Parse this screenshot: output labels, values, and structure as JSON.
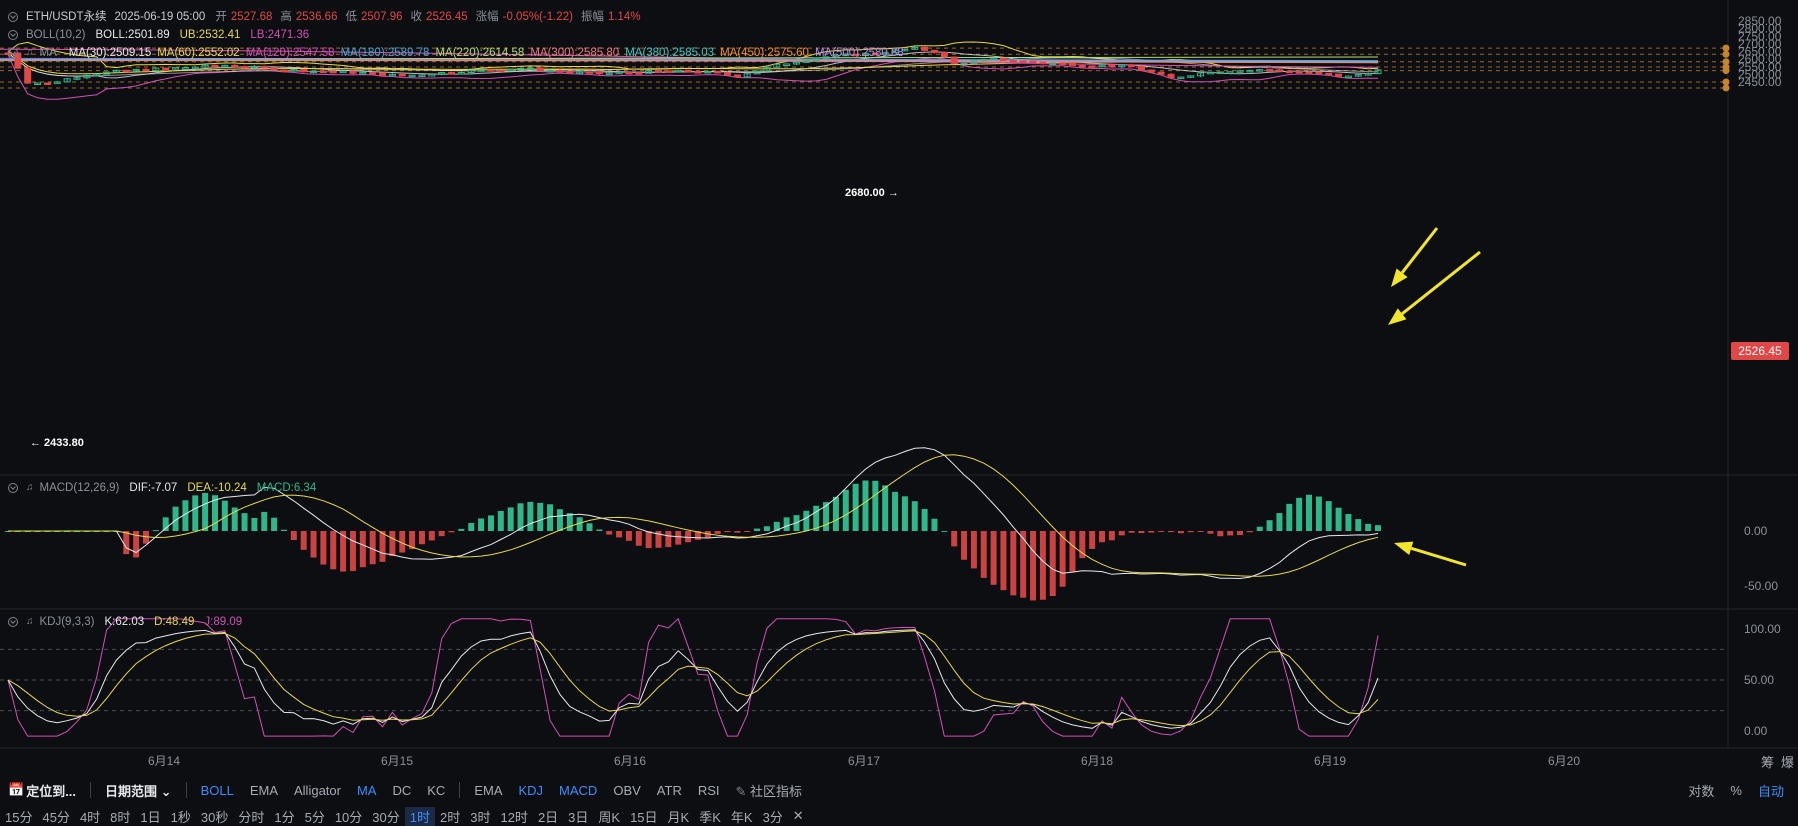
{
  "ohlc": {
    "symbol": "ETH/USDT永续",
    "datetime": "2025-06-19 05:00",
    "open_label": "开",
    "open": "2527.68",
    "high_label": "高",
    "high": "2536.66",
    "low_label": "低",
    "low": "2507.96",
    "close_label": "收",
    "close": "2526.45",
    "change_label": "涨幅",
    "change": "-0.05%(-1.22)",
    "amplitude_label": "振幅",
    "amplitude": "1.14%"
  },
  "boll": {
    "name": "BOLL(10,2)",
    "mid": "BOLL:2501.89",
    "ub": "UB:2532.41",
    "lb": "LB:2471.36"
  },
  "ma": {
    "name": "MA",
    "items": [
      {
        "text": "MA(30):2509.15",
        "color": "#e6e8ec"
      },
      {
        "text": "MA(60):2552.02",
        "color": "#e6d84a"
      },
      {
        "text": "MA(120):2547.58",
        "color": "#d24fb6"
      },
      {
        "text": "MA(180):2589.78",
        "color": "#3fa4d8"
      },
      {
        "text": "MA(220):2614.58",
        "color": "#b5dd6d"
      },
      {
        "text": "MA(300):2585.80",
        "color": "#e77a8a"
      },
      {
        "text": "MA(380):2585.03",
        "color": "#3cc7c7"
      },
      {
        "text": "MA(450):2575.60",
        "color": "#ef8d2d"
      },
      {
        "text": "MA(500):2580.88",
        "color": "#b18cf0"
      }
    ]
  },
  "macd": {
    "name": "MACD(12,26,9)",
    "dif": "DIF:-7.07",
    "dea": "DEA:-10.24",
    "macd": "MACD:6.34"
  },
  "kdj": {
    "name": "KDJ(9,3,3)",
    "k": "K:62.03",
    "d": "D:48.49",
    "j": "J:89.09"
  },
  "price_axis": [
    "2850.00",
    "2800.00",
    "2750.00",
    "2700.00",
    "2650.00",
    "2600.00",
    "2550.00",
    "2500.00",
    "2450.00"
  ],
  "macd_axis": [
    "0.00",
    "-50.00"
  ],
  "kdj_axis": [
    "100.00",
    "50.00",
    "0.00"
  ],
  "current_price": "2526.45",
  "annotations": {
    "high_marker": "2680.00 →",
    "low_marker": "← 2433.80"
  },
  "time_labels": [
    "6月14",
    "6月15",
    "6月16",
    "6月17",
    "6月18",
    "6月19",
    "6月20"
  ],
  "toolbar": {
    "locate": "定位到...",
    "date_range": "日期范围",
    "main_indicators": [
      "BOLL",
      "EMA",
      "Alligator",
      "MA",
      "DC",
      "KC"
    ],
    "sub_indicators": [
      "EMA",
      "KDJ",
      "MACD",
      "OBV",
      "ATR",
      "RSI"
    ],
    "community": "社区指标",
    "right": [
      "对数",
      "%",
      "自动"
    ],
    "side_labels": [
      "筹",
      "爆"
    ]
  },
  "timeframes": [
    "15分",
    "45分",
    "4时",
    "8时",
    "1日",
    "1秒",
    "30秒",
    "分时",
    "1分",
    "5分",
    "10分",
    "30分",
    "1时",
    "2时",
    "3时",
    "12时",
    "2日",
    "3日",
    "周K",
    "15日",
    "月K",
    "季K",
    "年K",
    "3分"
  ],
  "active_timeframe": "1时",
  "colors": {
    "up": "#2eb88a",
    "down": "#e04848",
    "background": "#0d0e11",
    "accent": "#3b8dff",
    "annotation_arrow": "#f3e52a"
  }
}
